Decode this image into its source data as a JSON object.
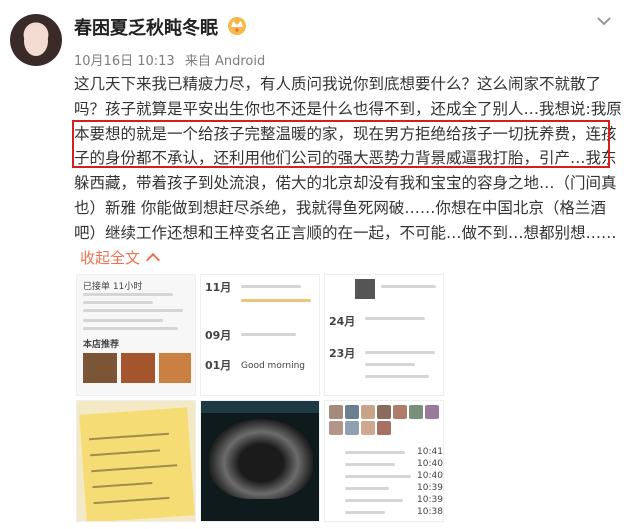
{
  "post": {
    "username": "春困夏乏秋盹冬眠",
    "timestamp": "10月16日 10:13",
    "source": "来自 Android",
    "lines": [
      "这几天下来我已精疲力尽，有人质问我说你到底想要什么？这么闹家不就散了",
      "吗？孩子就算是平安出生你也不还是什么也得不到，还成全了别人…我想说:我原",
      "本要想的就是一个给孩子完整温暖的家，现在男方拒绝给孩子一切抚养费，连孩",
      "子的身份都不承认，还利用他们公司的强大恶势力背景威逼我打胎，引产…我东",
      "躲西藏，带着孩子到处流浪，偌大的北京却没有我和宝宝的容身之地…（门间真",
      "也）新雅 你能做到想赶尽杀绝，我就得鱼死网破……你想在中国北京（格兰酒",
      "吧）继续工作还想和王梓变名正言顺的在一起，不可能…做不到…想都别想……"
    ],
    "collapse_label": "收起全文"
  },
  "thumbnails": {
    "t1": {
      "header": "已接单 11小时",
      "section": "本店推荐"
    },
    "t2": {
      "d1": "11月",
      "d2": "09月",
      "d3": "01月",
      "msg": "Good morning"
    },
    "t3": {
      "d1": "24月",
      "d2": "23月"
    },
    "t6": {
      "labels": [
        "10:41",
        "10:40",
        "10:40",
        "10:39",
        "10:39",
        "10:38"
      ]
    }
  },
  "icons": {
    "vip": "vip-crown-icon",
    "menu": "chevron-down-icon"
  },
  "colors": {
    "accent": "#eb7350",
    "highlight": "#d51f1f"
  }
}
